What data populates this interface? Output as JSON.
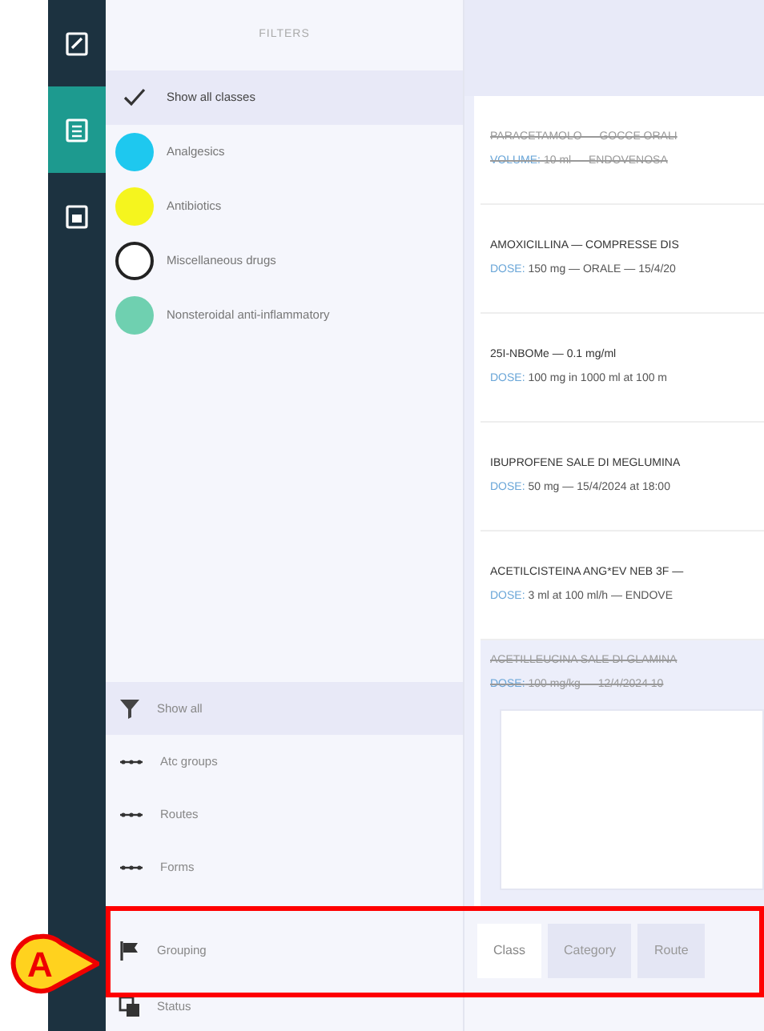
{
  "rail": {
    "items": [
      {
        "kind": "edit",
        "selected": false
      },
      {
        "kind": "list",
        "selected": true
      },
      {
        "kind": "calendar",
        "selected": false
      }
    ]
  },
  "filters": {
    "title": "FILTERS",
    "items": [
      {
        "kind": "all",
        "label": "Show all classes",
        "selected": true
      },
      {
        "kind": "class",
        "label": "Analgesics",
        "color": "#1ec8ef",
        "selected": false
      },
      {
        "kind": "class",
        "label": "Antibiotics",
        "color": "#f5f51e",
        "selected": false
      },
      {
        "kind": "class",
        "label": "Miscellaneous drugs",
        "color": "#ffffff",
        "selected": false
      },
      {
        "kind": "class",
        "label": "Nonsteroidal anti-inflammatory",
        "color": "#6fd0b0",
        "selected": false
      }
    ],
    "lower": [
      {
        "kind": "filter",
        "label": "Show all",
        "selected": true
      },
      {
        "kind": "group",
        "label": "Atc groups",
        "selected": false
      },
      {
        "kind": "group",
        "label": "Routes",
        "selected": false
      },
      {
        "kind": "group",
        "label": "Forms",
        "selected": false
      }
    ],
    "bottom": [
      {
        "kind": "grouping",
        "label": "Grouping"
      },
      {
        "kind": "status",
        "label": "Status"
      }
    ]
  },
  "therapies": [
    {
      "name": "PARACETAMOLO — GOCCE ORALI",
      "dose_label": "VOLUME:",
      "dose": "10 ml — ENDOVENOSA",
      "struck": true,
      "selected": false
    },
    {
      "name": "AMOXICILLINA — COMPRESSE DIS",
      "dose_label": "DOSE:",
      "dose": "150 mg — ORALE — 15/4/20",
      "struck": false,
      "selected": false
    },
    {
      "name": "25I-NBOMe — 0.1 mg/ml",
      "dose_label": "DOSE:",
      "dose": "100 mg in 1000 ml at 100 m",
      "struck": false,
      "selected": false
    },
    {
      "name": "IBUPROFENE SALE DI MEGLUMINA",
      "dose_label": "DOSE:",
      "dose": "50 mg — 15/4/2024 at 18:00",
      "struck": false,
      "selected": false
    },
    {
      "name": "ACETILCISTEINA ANG*EV NEB 3F —",
      "dose_label": "DOSE:",
      "dose": "3 ml at 100 ml/h — ENDOVE",
      "struck": false,
      "selected": false
    },
    {
      "name": "ACETILLEUCINA SALE DI GLAMINA",
      "dose_label": "DOSE:",
      "dose": "100 mg/kg — 12/4/2024 10",
      "struck": true,
      "selected": true
    }
  ],
  "grouping_tabs": [
    {
      "label": "Class",
      "selected": true
    },
    {
      "label": "Category",
      "selected": false
    },
    {
      "label": "Route",
      "selected": false
    }
  ],
  "callout": {
    "label": "A"
  }
}
